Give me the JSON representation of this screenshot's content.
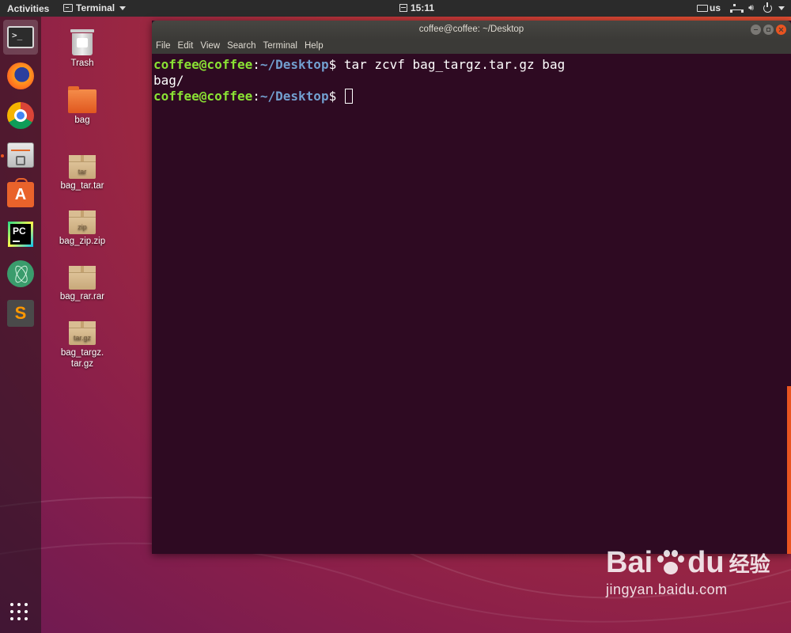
{
  "topbar": {
    "activities": "Activities",
    "app_menu": "Terminal",
    "clock": "15:11",
    "keyboard_layout": "us"
  },
  "dock": {
    "items": [
      {
        "name": "terminal",
        "icon": "terminal-icon",
        "active": true
      },
      {
        "name": "firefox",
        "icon": "firefox-icon"
      },
      {
        "name": "chrome",
        "icon": "chrome-icon"
      },
      {
        "name": "files",
        "icon": "files-icon",
        "running": true
      },
      {
        "name": "ubuntu-software",
        "icon": "software-icon"
      },
      {
        "name": "pycharm",
        "icon": "pycharm-icon",
        "label": "PC"
      },
      {
        "name": "atom",
        "icon": "atom-icon"
      },
      {
        "name": "sublime-text",
        "icon": "sublime-icon",
        "label": "S"
      }
    ],
    "show_apps_icon": "grid-icon"
  },
  "desktop": {
    "icons": [
      {
        "label": "Trash",
        "icon": "trash-icon"
      },
      {
        "label": "bag",
        "icon": "folder-icon"
      },
      {
        "label": "bag_tar.tar",
        "icon": "archive-icon",
        "badge": "tar"
      },
      {
        "label": "bag_zip.zip",
        "icon": "archive-icon",
        "badge": "zip"
      },
      {
        "label": "bag_rar.rar",
        "icon": "archive-icon",
        "badge": ""
      },
      {
        "label": "bag_targz.\ntar.gz",
        "icon": "archive-icon",
        "badge": "tar.gz"
      }
    ]
  },
  "terminal": {
    "title": "coffee@coffee: ~/Desktop",
    "menu": [
      "File",
      "Edit",
      "View",
      "Search",
      "Terminal",
      "Help"
    ],
    "prompt_user": "coffee@coffee",
    "prompt_sep": ":",
    "prompt_path": "~/Desktop",
    "prompt_sign": "$",
    "lines": [
      {
        "type": "command",
        "text": " tar zcvf bag_targz.tar.gz bag"
      },
      {
        "type": "output",
        "text": "bag/"
      },
      {
        "type": "command",
        "text": " "
      }
    ]
  },
  "watermark": {
    "logo_left": "Bai",
    "logo_right": "du",
    "logo_cn": "经验",
    "url": "jingyan.baidu.com"
  },
  "colors": {
    "accent": "#e95420",
    "terminal_bg": "#2e0a22",
    "prompt_user": "#8ae234",
    "prompt_path": "#729fcf"
  }
}
